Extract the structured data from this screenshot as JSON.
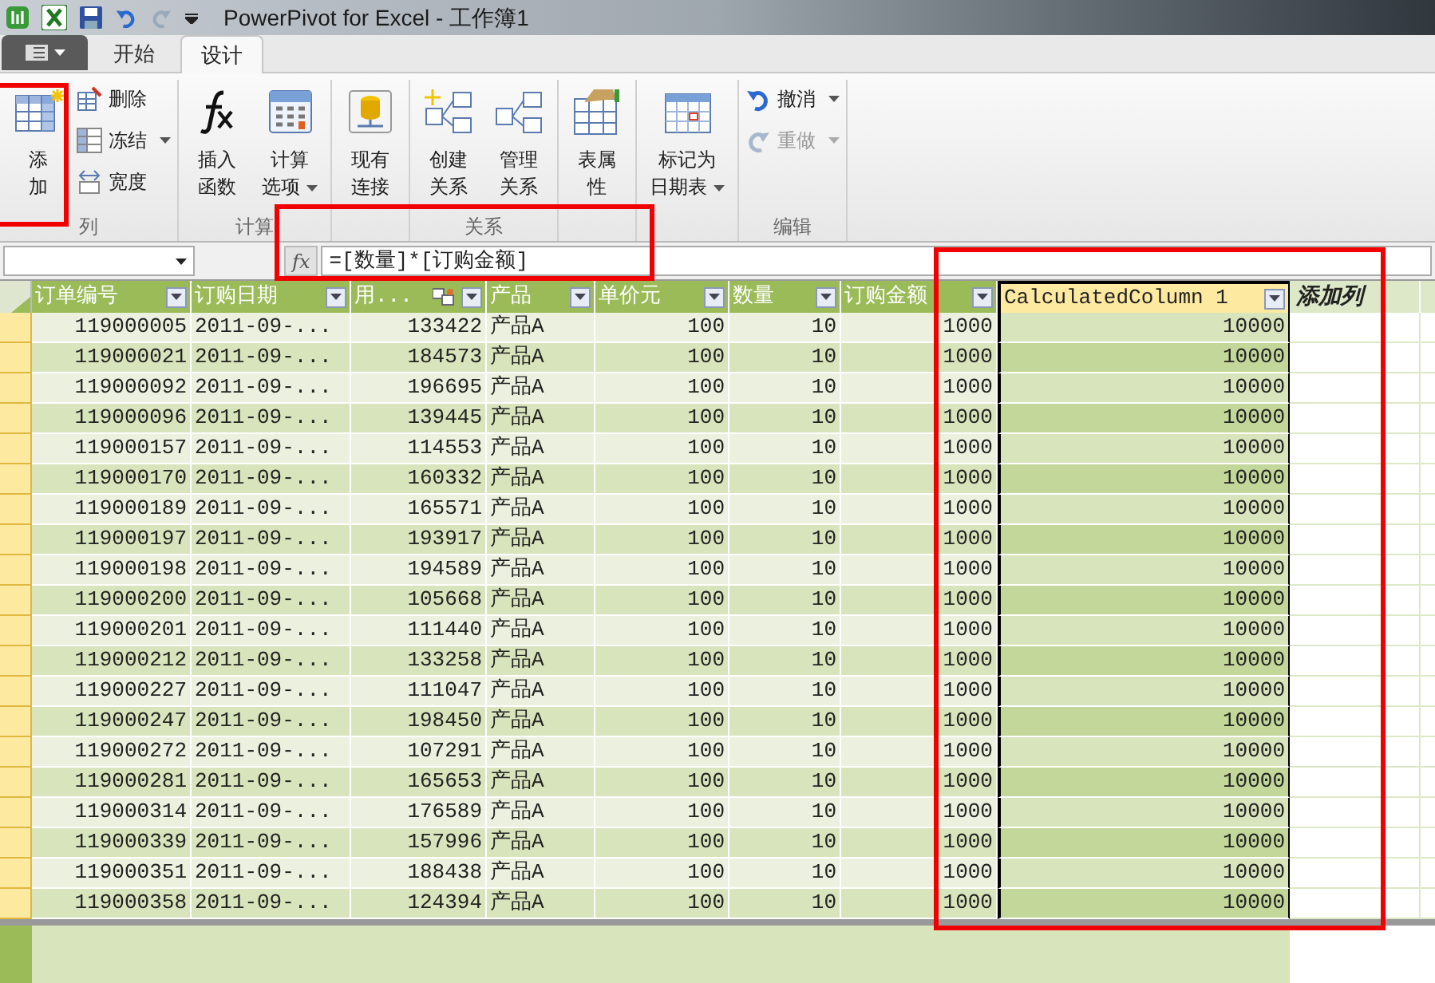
{
  "window": {
    "title": "PowerPivot for Excel - 工作簿1"
  },
  "tabs": [
    {
      "label": "开始",
      "selected": false
    },
    {
      "label": "设计",
      "selected": true
    }
  ],
  "ribbon_groups": [
    {
      "label": "列",
      "items": [
        {
          "kind": "large",
          "lines": [
            "添",
            "加"
          ]
        },
        {
          "kind": "small",
          "label": "删除",
          "dropdown": false
        },
        {
          "kind": "small",
          "label": "冻结",
          "dropdown": true
        },
        {
          "kind": "small",
          "label": "宽度",
          "dropdown": false
        }
      ]
    },
    {
      "label": "计算",
      "items": [
        {
          "kind": "large",
          "lines": [
            "插入",
            "函数"
          ],
          "dropdown": false
        },
        {
          "kind": "large",
          "lines": [
            "计算",
            "选项"
          ],
          "dropdown": true
        }
      ]
    },
    {
      "items": [
        {
          "kind": "large",
          "lines": [
            "现有",
            "连接"
          ],
          "dropdown": false
        }
      ]
    },
    {
      "label": "关系",
      "items": [
        {
          "kind": "large",
          "lines": [
            "创建",
            "关系"
          ],
          "dropdown": false
        },
        {
          "kind": "large",
          "lines": [
            "管理",
            "关系"
          ],
          "dropdown": false
        }
      ]
    },
    {
      "items": [
        {
          "kind": "large",
          "lines": [
            "表属",
            "性"
          ],
          "dropdown": false
        }
      ]
    },
    {
      "items": [
        {
          "kind": "large",
          "lines": [
            "标记为",
            "日期表"
          ],
          "dropdown": true
        }
      ]
    },
    {
      "label": "编辑",
      "items": [
        {
          "kind": "small",
          "label": "撤消",
          "dropdown": true,
          "disabled": false
        },
        {
          "kind": "small",
          "label": "重做",
          "dropdown": true,
          "disabled": true
        }
      ]
    }
  ],
  "function_button": "fx",
  "formula": "=[数量]*[订购金额]",
  "table": {
    "columns": [
      {
        "label": "订单编号",
        "selected": false
      },
      {
        "label": "订购日期",
        "selected": false
      },
      {
        "label": "用...",
        "selected": false,
        "related": true
      },
      {
        "label": "产品",
        "selected": false
      },
      {
        "label": "单价元",
        "selected": false
      },
      {
        "label": "数量",
        "selected": false
      },
      {
        "label": "订购金额",
        "selected": false
      },
      {
        "label": "CalculatedColumn 1",
        "selected": true
      }
    ],
    "add_column": "添加列",
    "rows": [
      [
        "119000005",
        "2011-09-...",
        "133422",
        "产品A",
        "100",
        "10",
        "1000",
        "10000"
      ],
      [
        "119000021",
        "2011-09-...",
        "184573",
        "产品A",
        "100",
        "10",
        "1000",
        "10000"
      ],
      [
        "119000092",
        "2011-09-...",
        "196695",
        "产品A",
        "100",
        "10",
        "1000",
        "10000"
      ],
      [
        "119000096",
        "2011-09-...",
        "139445",
        "产品A",
        "100",
        "10",
        "1000",
        "10000"
      ],
      [
        "119000157",
        "2011-09-...",
        "114553",
        "产品A",
        "100",
        "10",
        "1000",
        "10000"
      ],
      [
        "119000170",
        "2011-09-...",
        "160332",
        "产品A",
        "100",
        "10",
        "1000",
        "10000"
      ],
      [
        "119000189",
        "2011-09-...",
        "165571",
        "产品A",
        "100",
        "10",
        "1000",
        "10000"
      ],
      [
        "119000197",
        "2011-09-...",
        "193917",
        "产品A",
        "100",
        "10",
        "1000",
        "10000"
      ],
      [
        "119000198",
        "2011-09-...",
        "194589",
        "产品A",
        "100",
        "10",
        "1000",
        "10000"
      ],
      [
        "119000200",
        "2011-09-...",
        "105668",
        "产品A",
        "100",
        "10",
        "1000",
        "10000"
      ],
      [
        "119000201",
        "2011-09-...",
        "111440",
        "产品A",
        "100",
        "10",
        "1000",
        "10000"
      ],
      [
        "119000212",
        "2011-09-...",
        "133258",
        "产品A",
        "100",
        "10",
        "1000",
        "10000"
      ],
      [
        "119000227",
        "2011-09-...",
        "111047",
        "产品A",
        "100",
        "10",
        "1000",
        "10000"
      ],
      [
        "119000247",
        "2011-09-...",
        "198450",
        "产品A",
        "100",
        "10",
        "1000",
        "10000"
      ],
      [
        "119000272",
        "2011-09-...",
        "107291",
        "产品A",
        "100",
        "10",
        "1000",
        "10000"
      ],
      [
        "119000281",
        "2011-09-...",
        "165653",
        "产品A",
        "100",
        "10",
        "1000",
        "10000"
      ],
      [
        "119000314",
        "2011-09-...",
        "176589",
        "产品A",
        "100",
        "10",
        "1000",
        "10000"
      ],
      [
        "119000339",
        "2011-09-...",
        "157996",
        "产品A",
        "100",
        "10",
        "1000",
        "10000"
      ],
      [
        "119000351",
        "2011-09-...",
        "188438",
        "产品A",
        "100",
        "10",
        "1000",
        "10000"
      ],
      [
        "119000358",
        "2011-09-...",
        "124394",
        "产品A",
        "100",
        "10",
        "1000",
        "10000"
      ]
    ]
  }
}
